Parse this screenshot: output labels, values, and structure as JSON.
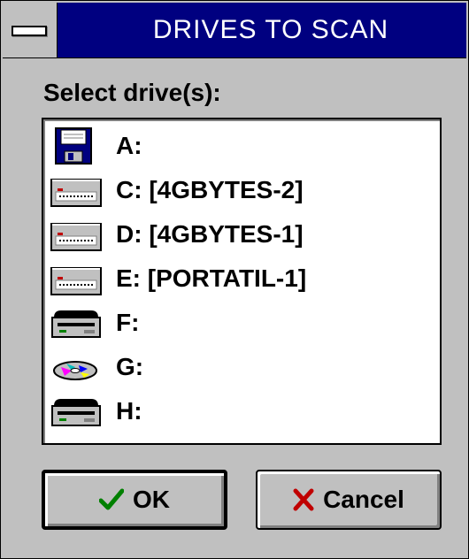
{
  "window": {
    "title": "DRIVES TO SCAN"
  },
  "prompt": {
    "label": "Select drive(s):"
  },
  "drives": [
    {
      "label": "A:",
      "icon": "floppy-disk-icon"
    },
    {
      "label": "C: [4GBYTES-2]",
      "icon": "hard-drive-icon"
    },
    {
      "label": "D: [4GBYTES-1]",
      "icon": "hard-drive-icon"
    },
    {
      "label": "E: [PORTATIL-1]",
      "icon": "hard-drive-icon"
    },
    {
      "label": "F:",
      "icon": "removable-drive-icon"
    },
    {
      "label": "G:",
      "icon": "cd-rom-icon"
    },
    {
      "label": "H:",
      "icon": "removable-drive-icon"
    }
  ],
  "buttons": {
    "ok_label": "OK",
    "cancel_label": "Cancel"
  },
  "colors": {
    "titlebar": "#000080",
    "dialog_bg": "#c0c0c0",
    "ok_check": "#008000",
    "cancel_x": "#c00000"
  }
}
